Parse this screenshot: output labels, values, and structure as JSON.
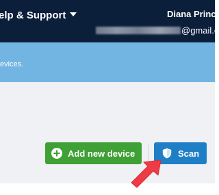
{
  "header": {
    "help_menu_label": "elp & Support",
    "user_name": "Diana Princ",
    "user_email_visible": "@gmail.c"
  },
  "banner": {
    "text": "evices."
  },
  "actions": {
    "add_device_label": "Add new device",
    "scan_label": "Scan"
  },
  "icons": {
    "add": "plus-circle-icon",
    "scan": "shield-icon",
    "pointer": "red-arrow-icon",
    "dropdown": "chevron-down-icon"
  },
  "colors": {
    "topbar": "#0b1e3a",
    "banner": "#72b5e3",
    "content_bg": "#eff1f4",
    "add_button": "#3fa035",
    "scan_button": "#1f7fc6",
    "arrow": "#ef3b45"
  }
}
